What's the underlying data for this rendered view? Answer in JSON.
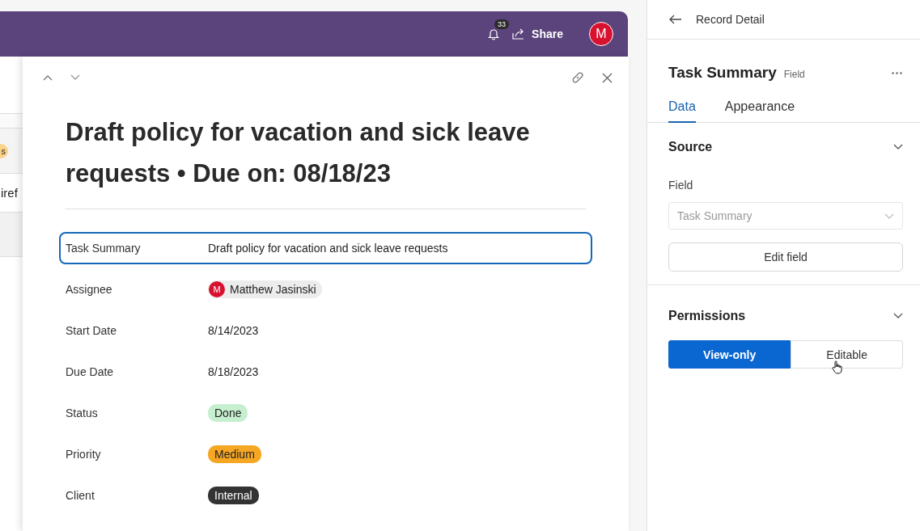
{
  "app_header": {
    "notification_count": "33",
    "share_label": "Share",
    "avatar_initial": "M"
  },
  "background_list": {
    "badge": "s",
    "row_text": "iref"
  },
  "record": {
    "title": "Draft policy for vacation and sick leave requests • Due on: 08/18/23",
    "fields": [
      {
        "label": "Task Summary",
        "kind": "text",
        "value": "Draft policy for vacation and sick leave requests",
        "selected": true
      },
      {
        "label": "Assignee",
        "kind": "person",
        "value": "Matthew Jasinski",
        "avatar_initial": "M",
        "selected": false
      },
      {
        "label": "Start Date",
        "kind": "text",
        "value": "8/14/2023",
        "selected": false
      },
      {
        "label": "Due Date",
        "kind": "text",
        "value": "8/18/2023",
        "selected": false
      },
      {
        "label": "Status",
        "kind": "tag",
        "value": "Done",
        "color": "#c6efcf",
        "selected": false
      },
      {
        "label": "Priority",
        "kind": "tag",
        "value": "Medium",
        "color": "#f5a623",
        "selected": false
      },
      {
        "label": "Client",
        "kind": "tag",
        "value": "Internal",
        "color": "#333333",
        "selected": false
      }
    ]
  },
  "panel": {
    "back_label": "Record Detail",
    "heading": "Task Summary",
    "heading_note": "Field",
    "tabs": [
      {
        "label": "Data",
        "selected": true
      },
      {
        "label": "Appearance",
        "selected": false
      }
    ],
    "source": {
      "title": "Source",
      "expanded": true,
      "field_label": "Field",
      "field_value": "Task Summary",
      "button": "Edit field"
    },
    "permissions": {
      "title": "Permissions",
      "expanded": true,
      "options": [
        {
          "label": "View-only",
          "selected": true
        },
        {
          "label": "Editable",
          "selected": false
        }
      ]
    }
  }
}
